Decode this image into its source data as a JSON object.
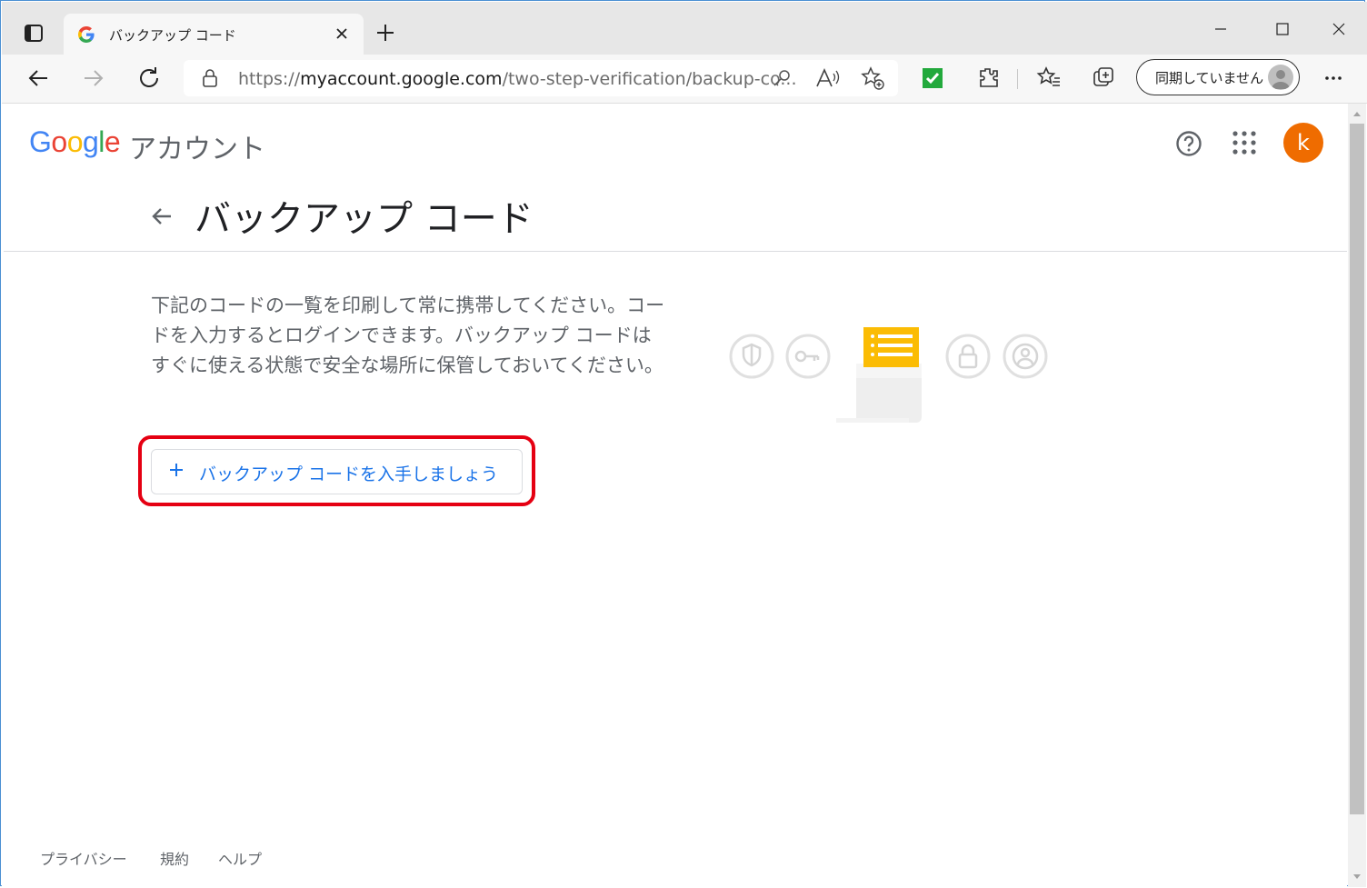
{
  "browser": {
    "tab_title": "バックアップ コード",
    "url_prefix": "https://",
    "url_domain": "myaccount.google.com",
    "url_path": "/two-step-verification/backup-co...",
    "sync_label": "同期していません"
  },
  "header": {
    "logo_text": "Google",
    "account_label": "アカウント",
    "avatar_letter": "k",
    "avatar_color": "#ef6c00"
  },
  "main": {
    "title": "バックアップ コード",
    "description": "下記のコードの一覧を印刷して常に携帯してください。コードを入力するとログインできます。バックアップ コードはすぐに使える状態で安全な場所に保管しておいてください。",
    "cta_label": "バックアップ コードを入手しましょう",
    "accent_color": "#1a73e8",
    "highlight_color": "#e50012"
  },
  "footer": {
    "privacy": "プライバシー",
    "terms": "規約",
    "help": "ヘルプ"
  }
}
